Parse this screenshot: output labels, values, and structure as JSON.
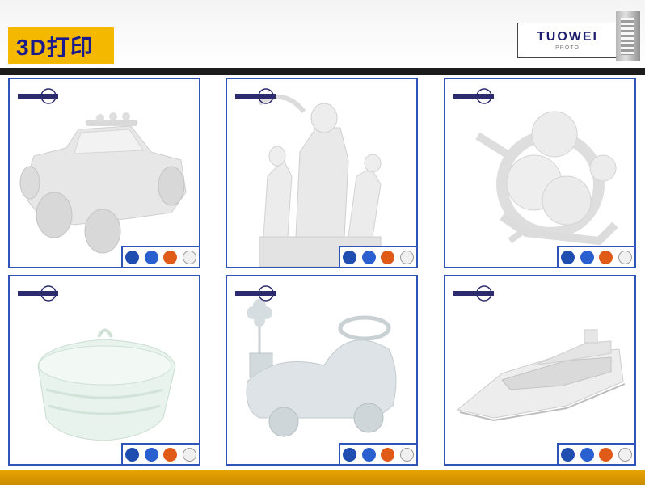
{
  "header": {
    "title": "3D打印"
  },
  "logo": {
    "main": "TUOWEI",
    "sub": "PROTO"
  },
  "gallery": [
    {
      "name": "car"
    },
    {
      "name": "statue"
    },
    {
      "name": "gear-mechanism"
    },
    {
      "name": "basket"
    },
    {
      "name": "ride-on-toy"
    },
    {
      "name": "yacht"
    }
  ],
  "colors": {
    "accent": "#f5b800",
    "frame": "#2f54b7",
    "title_text": "#1a1a8c"
  }
}
